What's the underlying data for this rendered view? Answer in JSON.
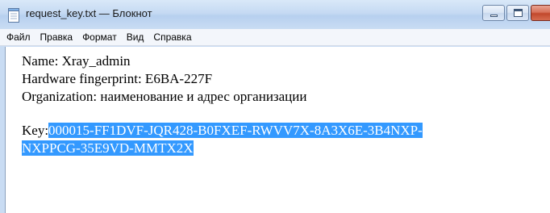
{
  "window": {
    "title": "request_key.txt — Блокнот",
    "icon": "notepad-icon",
    "buttons": [
      "minimize-icon",
      "maximize-icon",
      "close-icon"
    ]
  },
  "menu": {
    "items": [
      {
        "label": "Файл"
      },
      {
        "label": "Правка"
      },
      {
        "label": "Формат"
      },
      {
        "label": "Вид"
      },
      {
        "label": "Справка"
      }
    ]
  },
  "document": {
    "lines": [
      "Name: Xray_admin",
      "Hardware fingerprint: E6BA-227F",
      "Organization: наименование и адрес организации"
    ],
    "key_label": "Key:",
    "key_line1": "000015-FF1DVF-JQR428-B0FXEF-RWVV7X-8A3X6E-3B4NXP-",
    "key_line2": "NXPPCG-35E9VD-MMTX2X "
  },
  "colors": {
    "selection": "#3399ff",
    "titlebar": "#c9dcf3",
    "close_button": "#c2482c"
  }
}
